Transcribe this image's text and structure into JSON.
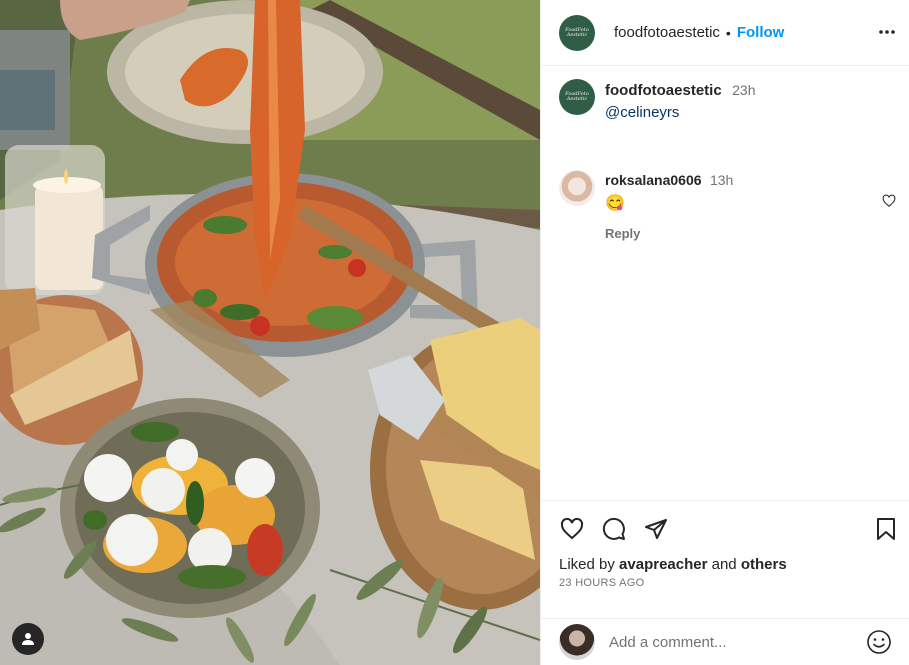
{
  "post": {
    "author": {
      "username": "foodfotoaestetic",
      "avatar_text": "FoodFoto Aestetic"
    },
    "follow_label": "Follow",
    "separator": "•",
    "more_icon": "more-horizontal-icon",
    "caption": {
      "username": "foodfotoaestetic",
      "time": "23h",
      "text": "@celineyrs"
    },
    "comments": [
      {
        "username": "roksalana0606",
        "time": "13h",
        "text": "😋",
        "reply_label": "Reply"
      }
    ],
    "actions": {
      "icons": [
        "heart-icon",
        "comment-icon",
        "share-icon",
        "bookmark-icon"
      ],
      "liked_by_prefix": "Liked by",
      "liked_by_user": "avapreacher",
      "liked_by_and": "and",
      "liked_by_others": "others",
      "timestamp": "23 HOURS AGO"
    },
    "add_comment": {
      "placeholder": "Add a comment..."
    }
  },
  "colors": {
    "accent": "#0095f6",
    "text": "#262626",
    "muted": "#737373",
    "mention": "#00376b",
    "avatar_green": "#2f5d46"
  }
}
